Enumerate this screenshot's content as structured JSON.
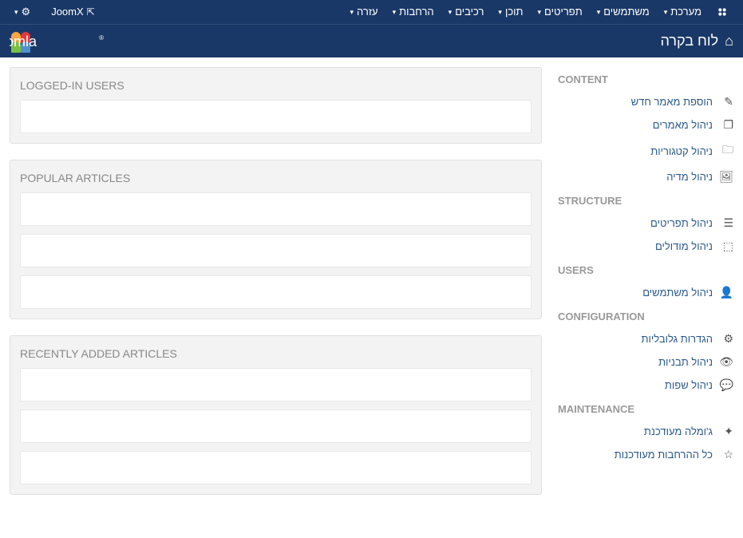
{
  "topbar": {
    "site_name": "JoomX",
    "menus": [
      {
        "label": "מערכת"
      },
      {
        "label": "משתמשים"
      },
      {
        "label": "תפריטים"
      },
      {
        "label": "תוכן"
      },
      {
        "label": "רכיבים"
      },
      {
        "label": "הרחבות"
      },
      {
        "label": "עזרה"
      }
    ]
  },
  "header": {
    "title": "לוח בקרה"
  },
  "sidebar": {
    "sections": [
      {
        "heading": "CONTENT",
        "items": [
          {
            "icon": "✎",
            "label": "הוספת מאמר חדש"
          },
          {
            "icon": "❐",
            "label": "ניהול מאמרים"
          },
          {
            "icon": "🗀",
            "label": "ניהול קטגוריות"
          },
          {
            "icon": "🖼",
            "label": "ניהול מדיה"
          }
        ]
      },
      {
        "heading": "STRUCTURE",
        "items": [
          {
            "icon": "☰",
            "label": "ניהול תפריטים"
          },
          {
            "icon": "⬚",
            "label": "ניהול מודולים"
          }
        ]
      },
      {
        "heading": "USERS",
        "items": [
          {
            "icon": "👤",
            "label": "ניהול משתמשים"
          }
        ]
      },
      {
        "heading": "CONFIGURATION",
        "items": [
          {
            "icon": "⚙",
            "label": "הגדרות גלובליות"
          },
          {
            "icon": "👁",
            "label": "ניהול תבניות"
          },
          {
            "icon": "💬",
            "label": "ניהול שפות"
          }
        ]
      },
      {
        "heading": "MAINTENANCE",
        "items": [
          {
            "icon": "✦",
            "label": "ג'ומלה מעודכנת"
          },
          {
            "icon": "☆",
            "label": "כל ההרחבות מעודכנות"
          }
        ]
      }
    ]
  },
  "panels": {
    "logged_in": {
      "title": "LOGGED-IN USERS",
      "rows": 1
    },
    "popular": {
      "title": "POPULAR ARTICLES",
      "rows": 3
    },
    "recent": {
      "title": "RECENTLY ADDED ARTICLES",
      "rows": 3
    }
  }
}
